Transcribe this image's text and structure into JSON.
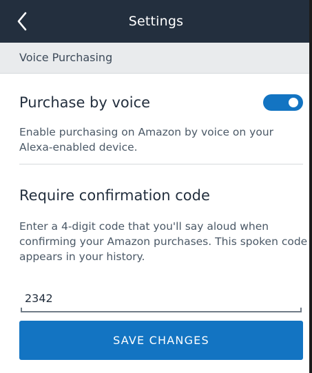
{
  "header": {
    "back_icon": "chevron-left-icon",
    "title": "Settings"
  },
  "section": {
    "title": "Voice Purchasing"
  },
  "purchase_by_voice": {
    "label": "Purchase by voice",
    "enabled": true,
    "description": "Enable purchasing on Amazon by voice on your Alexa-enabled device."
  },
  "confirmation_code": {
    "label": "Require confirmation code",
    "description": "Enter a 4-digit code that you'll say aloud when confirming your Amazon purchases. This spoken code appears in your history.",
    "value": "2342"
  },
  "actions": {
    "save_label": "SAVE CHANGES"
  },
  "colors": {
    "header_bg": "#232f3e",
    "subheader_bg": "#e9ebed",
    "accent": "#1374c2"
  }
}
